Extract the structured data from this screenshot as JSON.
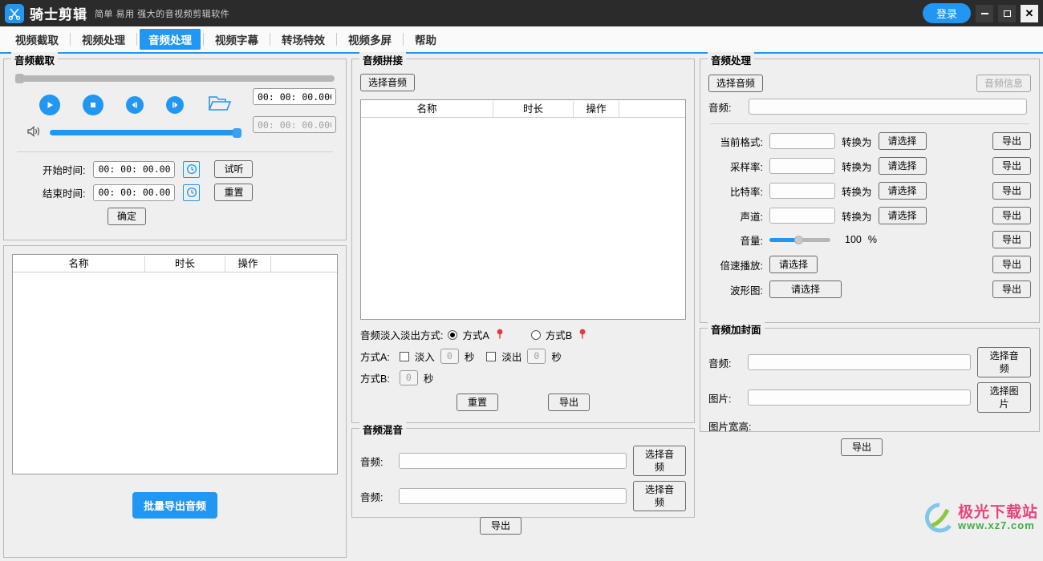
{
  "titlebar": {
    "app_title": "骑士剪辑",
    "subtitle": "简单  易用  强大的音视频剪辑软件",
    "login_label": "登录",
    "logo_icon": "scissors-icon",
    "minimize_icon": "minimize-icon",
    "maximize_icon": "maximize-icon",
    "close_icon": "close-icon",
    "accent_color": "#2196f3",
    "bar_color": "#2b2b2b"
  },
  "nav": {
    "items": [
      {
        "label": "视频截取",
        "active": false
      },
      {
        "label": "视频处理",
        "active": false
      },
      {
        "label": "音频处理",
        "active": true
      },
      {
        "label": "视频字幕",
        "active": false
      },
      {
        "label": "转场特效",
        "active": false
      },
      {
        "label": "视频多屏",
        "active": false
      },
      {
        "label": "帮助",
        "active": false
      }
    ]
  },
  "audio_capture": {
    "title": "音频截取",
    "progress_value": 0,
    "volume_value": 100,
    "current_time": "00: 00: 00.000",
    "total_time": "00: 00: 00.000",
    "play_icon": "play-icon",
    "stop_icon": "stop-icon",
    "rewind_icon": "rewind-icon",
    "forward_icon": "forward-icon",
    "folder_icon": "folder-open-icon",
    "volume_icon": "volume-icon",
    "start_label": "开始时间:",
    "start_value": "00: 00: 00.000",
    "end_label": "结束时间:",
    "end_value": "00: 00: 00.000",
    "clock_icon": "clock-icon",
    "preview_label": "试听",
    "reset_label": "重置",
    "confirm_label": "确定",
    "table_headers": [
      "名称",
      "时长",
      "操作"
    ],
    "table_rows": [],
    "batch_export_label": "批量导出音频"
  },
  "audio_splice": {
    "title": "音频拼接",
    "select_audio_label": "选择音频",
    "table_headers": [
      "名称",
      "时长",
      "操作"
    ],
    "table_rows": [],
    "fade_mode_label": "音频淡入淡出方式:",
    "mode_a_label": "方式A",
    "mode_b_label": "方式B",
    "mode_a_selected": true,
    "help_icon": "help-pin-icon",
    "row_a_label": "方式A:",
    "fade_in_label": "淡入",
    "fade_in_value": "0",
    "fade_out_label": "淡出",
    "fade_out_value": "0",
    "second_unit": "秒",
    "row_b_label": "方式B:",
    "mode_b_value": "0",
    "reset_label": "重置",
    "export_label": "导出"
  },
  "audio_mix": {
    "title": "音频混音",
    "audio1_label": "音频:",
    "audio1_value": "",
    "audio2_label": "音频:",
    "audio2_value": "",
    "select_audio_label": "选择音频",
    "export_label": "导出"
  },
  "audio_process": {
    "title": "音频处理",
    "select_audio_label": "选择音频",
    "audio_info_label": "音频信息",
    "audio_label": "音频:",
    "audio_value": "",
    "convert_to_label": "转换为",
    "please_select_label": "请选择",
    "export_label": "导出",
    "rows": [
      {
        "label": "当前格式:",
        "value": ""
      },
      {
        "label": "采样率:",
        "value": ""
      },
      {
        "label": "比特率:",
        "value": ""
      },
      {
        "label": "声道:",
        "value": ""
      }
    ],
    "volume_label": "音量:",
    "volume_value": "100",
    "volume_unit": "%",
    "speed_label": "倍速播放:",
    "waveform_label": "波形图:"
  },
  "audio_cover": {
    "title": "音频加封面",
    "audio_label": "音频:",
    "audio_value": "",
    "select_audio_label": "选择音频",
    "image_label": "图片:",
    "image_value": "",
    "select_image_label": "选择图片",
    "size_label": "图片宽高:",
    "export_label": "导出"
  },
  "watermark": {
    "title": "极光下载站",
    "url": "www.xz7.com",
    "logo_icon": "aurora-logo-icon"
  }
}
